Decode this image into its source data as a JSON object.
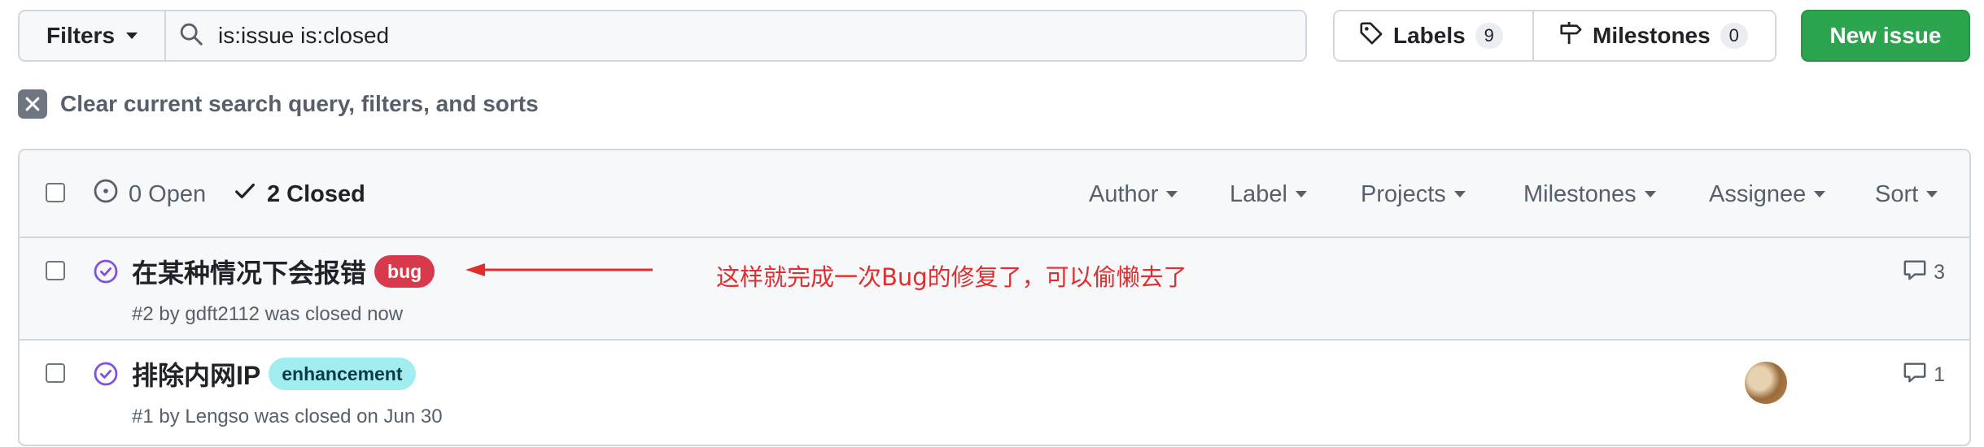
{
  "toolbar": {
    "filters_label": "Filters",
    "search_value": "is:issue is:closed",
    "labels_label": "Labels",
    "labels_count": "9",
    "milestones_label": "Milestones",
    "milestones_count": "0",
    "new_issue_label": "New issue"
  },
  "clear_filters": {
    "text": "Clear current search query, filters, and sorts"
  },
  "list_header": {
    "open_label": "0 Open",
    "closed_label": "2 Closed",
    "filters": {
      "author": "Author",
      "label": "Label",
      "projects": "Projects",
      "milestones": "Milestones",
      "assignee": "Assignee",
      "sort": "Sort"
    }
  },
  "issues": [
    {
      "title": "在某种情况下会报错",
      "label": {
        "name": "bug",
        "bg": "#d73a4a",
        "fg": "#ffffff"
      },
      "meta": "#2 by gdft2112 was closed now",
      "comments": "3",
      "has_assignee": false
    },
    {
      "title": "排除内网IP",
      "label": {
        "name": "enhancement",
        "bg": "#a2eeef",
        "fg": "#0a3a4a"
      },
      "meta": "#1 by Lengso was closed on Jun 30",
      "comments": "1",
      "has_assignee": true
    }
  ],
  "annotation": {
    "text": "这样就完成一次Bug的修复了，可以偷懒去了",
    "color": "#e02e2e"
  },
  "colors": {
    "closed_icon": "#8250df",
    "primary_button": "#2da44e",
    "border": "#d0d7de",
    "muted_text": "#57606a"
  },
  "icons": {
    "search": "search-icon",
    "labels": "tag-icon",
    "milestones": "milestone-icon",
    "clear": "x-icon",
    "open_state": "issue-opened-icon",
    "closed_state": "check-icon",
    "issue_closed": "issue-closed-icon",
    "comments": "comment-icon"
  }
}
